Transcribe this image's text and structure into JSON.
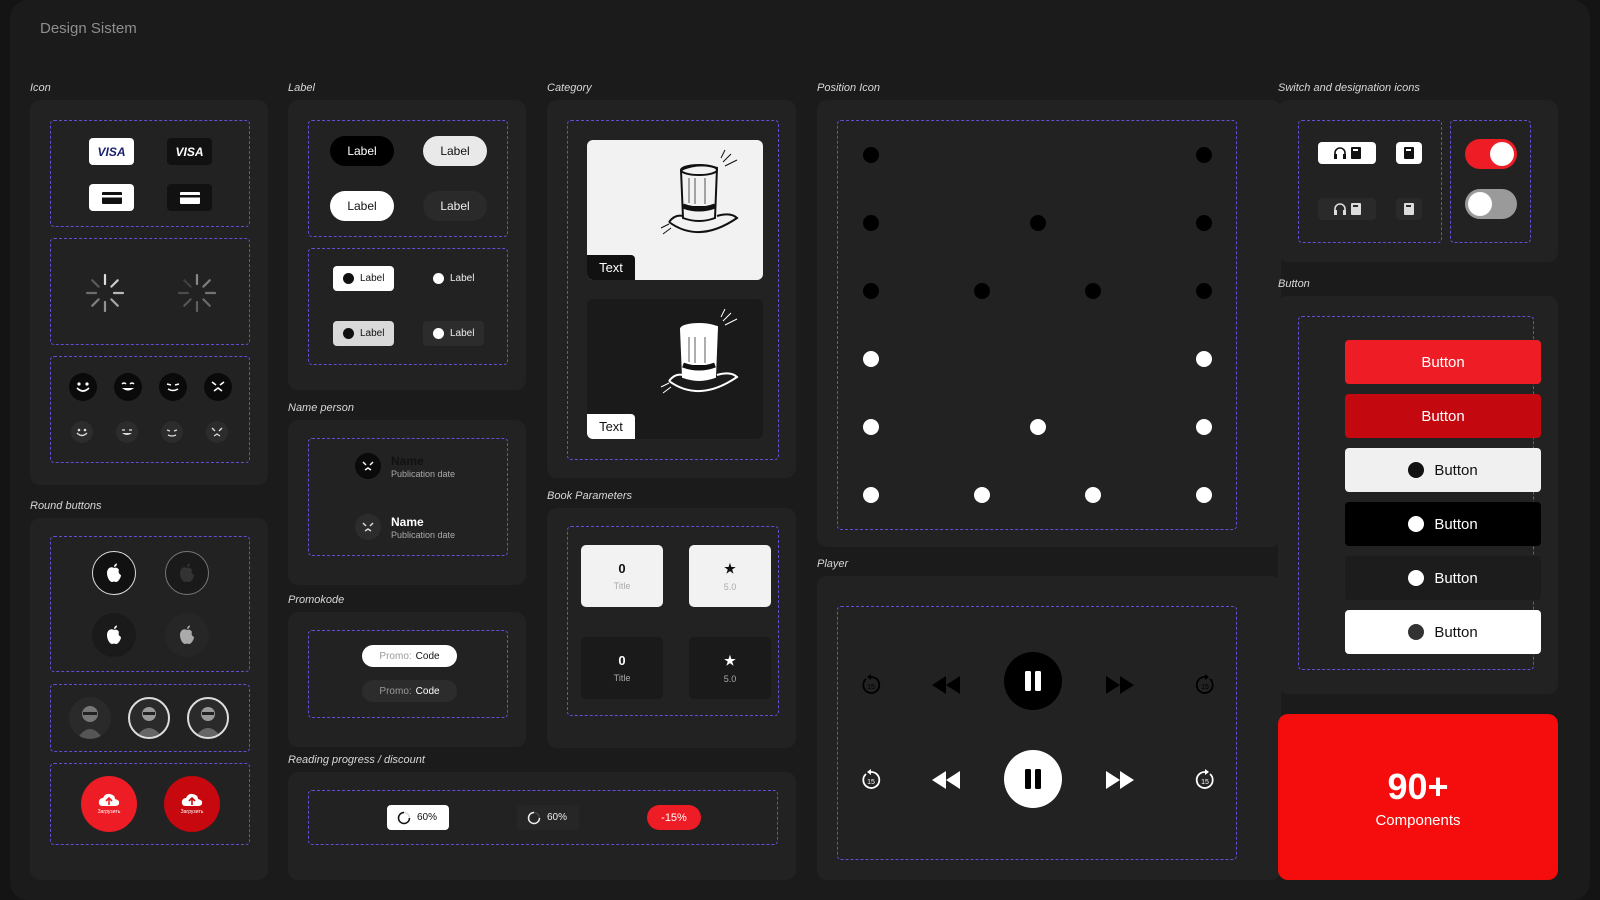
{
  "page_title": "Design Sistem",
  "sections": {
    "icon": "Icon",
    "round_buttons": "Round buttons",
    "label": "Label",
    "name_person": "Name person",
    "promokode": "Promokode",
    "reading_progress": "Reading progress / discount",
    "category": "Category",
    "book_parameters": "Book Parameters",
    "position_icon": "Position Icon",
    "player": "Player",
    "switch_icons": "Switch and designation icons",
    "button": "Button"
  },
  "icon": {
    "visa_light": "VISA",
    "visa_dark": "VISA"
  },
  "labels": {
    "pills": [
      "Label",
      "Label",
      "Label",
      "Label"
    ],
    "tags": [
      "Label",
      "Label",
      "Label",
      "Label"
    ]
  },
  "name_person": [
    {
      "name": "Name",
      "sub": "Publication date"
    },
    {
      "name": "Name",
      "sub": "Publication date"
    }
  ],
  "promo": [
    {
      "prefix": "Promo:",
      "code": "Code"
    },
    {
      "prefix": "Promo:",
      "code": "Code"
    }
  ],
  "reading": {
    "progress_light": "60%",
    "progress_dark": "60%",
    "discount": "-15%"
  },
  "category": {
    "card_light_text": "Text",
    "card_dark_text": "Text"
  },
  "book_params": [
    {
      "value": "0",
      "title": "Title"
    },
    {
      "value": "★",
      "title": "5.0"
    },
    {
      "value": "0",
      "title": "Title"
    },
    {
      "value": "★",
      "title": "5.0"
    }
  ],
  "upload": {
    "label": "Загрузить"
  },
  "buttons": [
    "Button",
    "Button",
    "Button",
    "Button",
    "Button",
    "Button"
  ],
  "promo_card": {
    "big": "90+",
    "small": "Components"
  },
  "colors": {
    "accent_red": "#ee1c24",
    "dark_red": "#c4080f",
    "purple_dash": "#6a4bd6",
    "panel": "#222222",
    "background": "#1b1b1b"
  }
}
